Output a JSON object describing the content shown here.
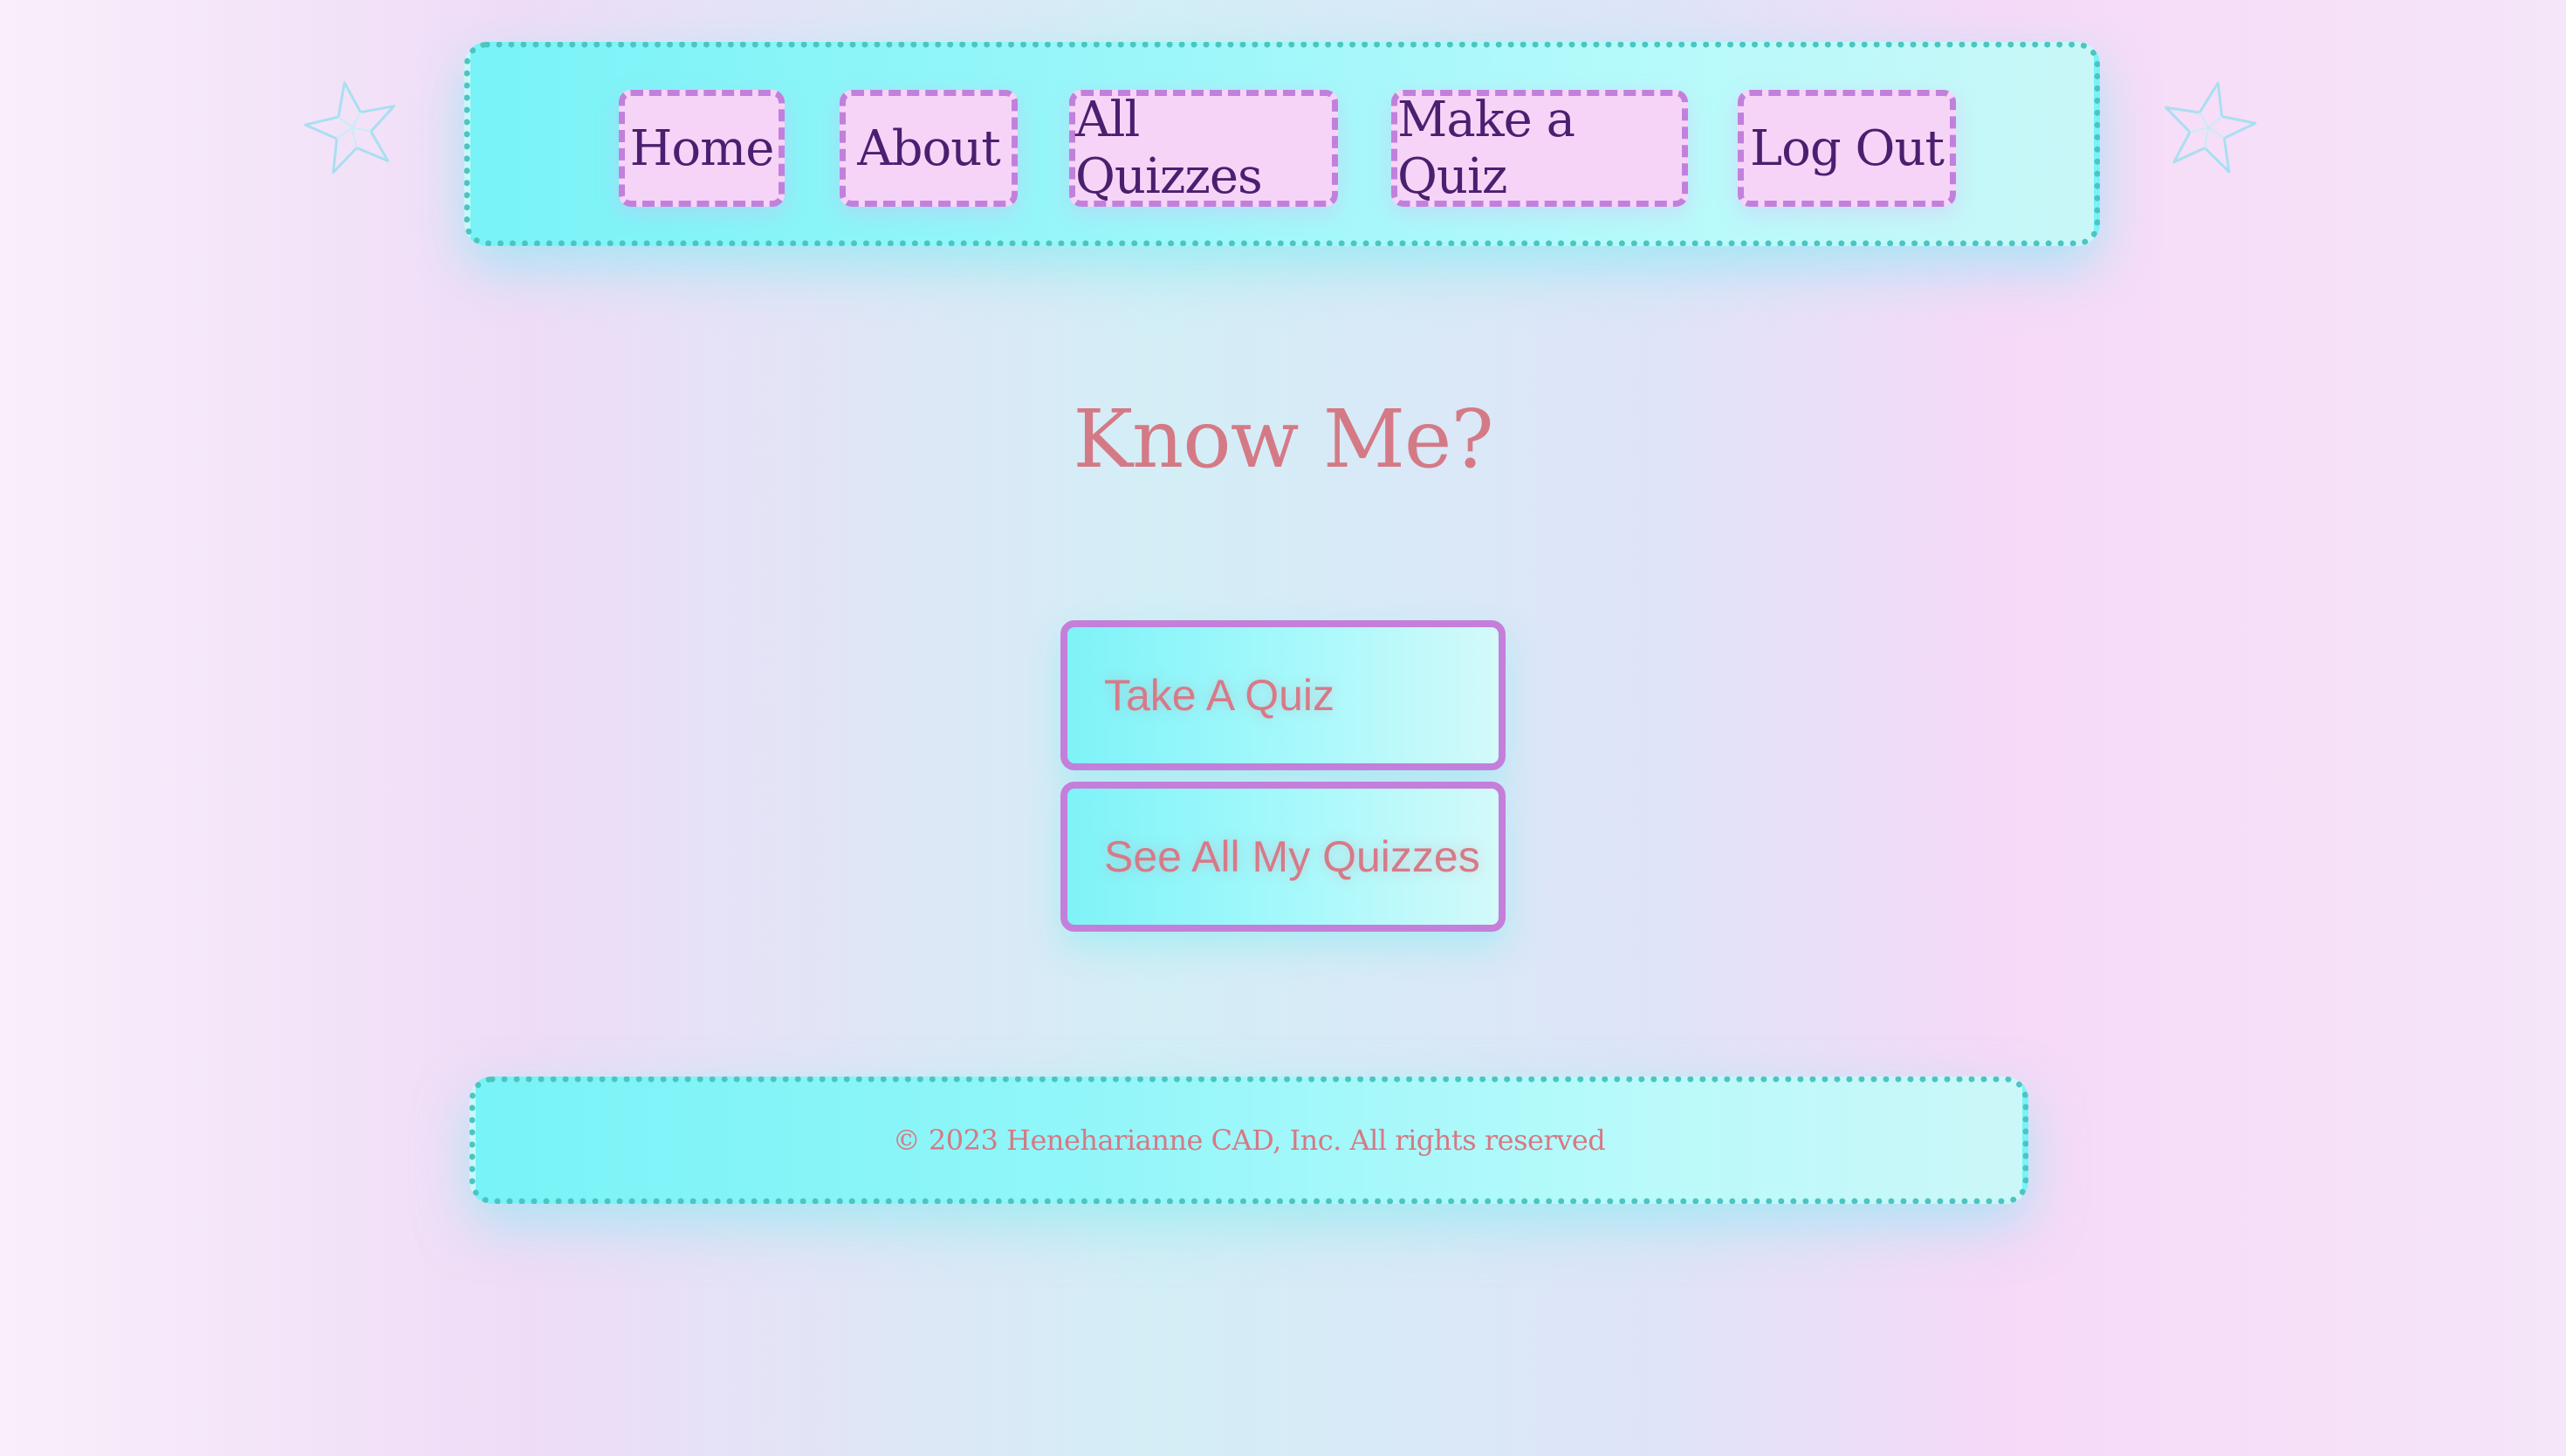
{
  "nav": {
    "items": [
      {
        "label": "Home"
      },
      {
        "label": "About"
      },
      {
        "label": "All Quizzes"
      },
      {
        "label": "Make a Quiz"
      },
      {
        "label": "Log Out"
      }
    ]
  },
  "main": {
    "title": "Know Me?",
    "take_quiz_label": "Take A Quiz",
    "see_quizzes_label": "See All My Quizzes"
  },
  "footer": {
    "text": "© 2023 Heneharianne CAD, Inc. All rights reserved"
  },
  "icons": {
    "left_decoration": "star-icon",
    "right_decoration": "star-icon"
  },
  "colors": {
    "nav_border": "#4cc5c0",
    "nav_button_border": "#c280dc",
    "nav_button_fill": "#f6d4f7",
    "nav_text": "#4b1f6f",
    "title": "#d47a86",
    "action_border": "#c47fdb",
    "action_text": "#d77a88",
    "cyan_fill": "#7ef3f8"
  }
}
